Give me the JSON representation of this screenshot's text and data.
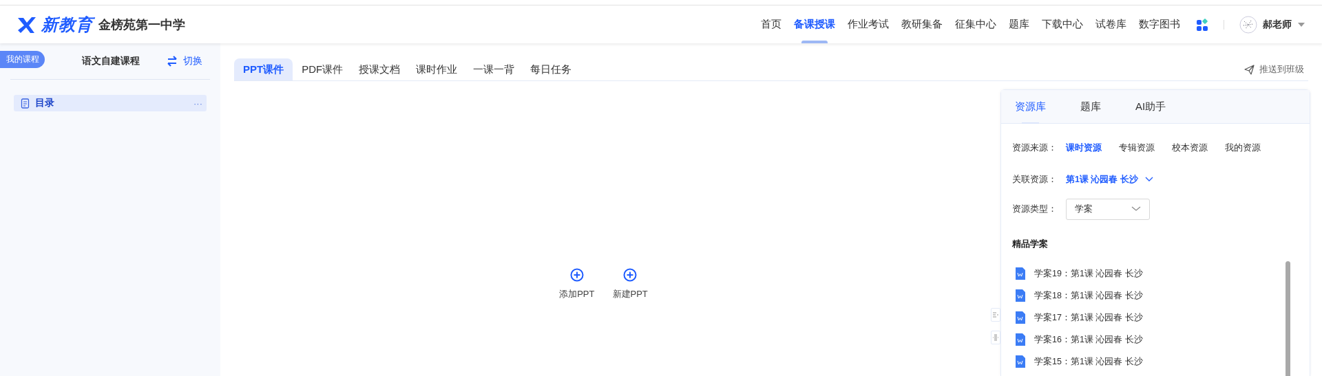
{
  "logo": {
    "brand": "新教育",
    "school": "金榜苑第一中学"
  },
  "nav": [
    {
      "label": "首页",
      "selected": false
    },
    {
      "label": "备课授课",
      "selected": true
    },
    {
      "label": "作业考试",
      "selected": false
    },
    {
      "label": "教研集备",
      "selected": false
    },
    {
      "label": "征集中心",
      "selected": false
    },
    {
      "label": "题库",
      "selected": false
    },
    {
      "label": "下载中心",
      "selected": false
    },
    {
      "label": "试卷库",
      "selected": false
    },
    {
      "label": "数字图书",
      "selected": false
    }
  ],
  "user": {
    "name": "郝老师"
  },
  "sidebar": {
    "badge": "我的课程",
    "course": "语文自建课程",
    "switch": "切换",
    "items": [
      {
        "label": "目录",
        "selected": true,
        "more": "···"
      }
    ]
  },
  "tabs": [
    {
      "label": "PPT课件",
      "selected": true
    },
    {
      "label": "PDF课件",
      "selected": false
    },
    {
      "label": "授课文档",
      "selected": false
    },
    {
      "label": "课时作业",
      "selected": false
    },
    {
      "label": "一课一背",
      "selected": false
    },
    {
      "label": "每日任务",
      "selected": false
    }
  ],
  "push_button": "推送到班级",
  "actions": [
    {
      "label": "添加PPT"
    },
    {
      "label": "新建PPT"
    }
  ],
  "resource_panel": {
    "tabs": [
      {
        "label": "资源库",
        "selected": true
      },
      {
        "label": "题库",
        "selected": false
      },
      {
        "label": "AI助手",
        "selected": false
      }
    ],
    "source": {
      "label": "资源来源：",
      "options": [
        {
          "label": "课时资源",
          "selected": true
        },
        {
          "label": "专辑资源",
          "selected": false
        },
        {
          "label": "校本资源",
          "selected": false
        },
        {
          "label": "我的资源",
          "selected": false
        }
      ]
    },
    "related": {
      "label": "关联资源：",
      "value": "第1课 沁园春 长沙"
    },
    "type": {
      "label": "资源类型：",
      "value": "学案"
    },
    "section_title": "精品学案",
    "items": [
      "学案19：第1课 沁园春 长沙",
      "学案18：第1课 沁园春 长沙",
      "学案17：第1课 沁园春 长沙",
      "学案16：第1课 沁园春 长沙",
      "学案15：第1课 沁园春 长沙"
    ]
  }
}
